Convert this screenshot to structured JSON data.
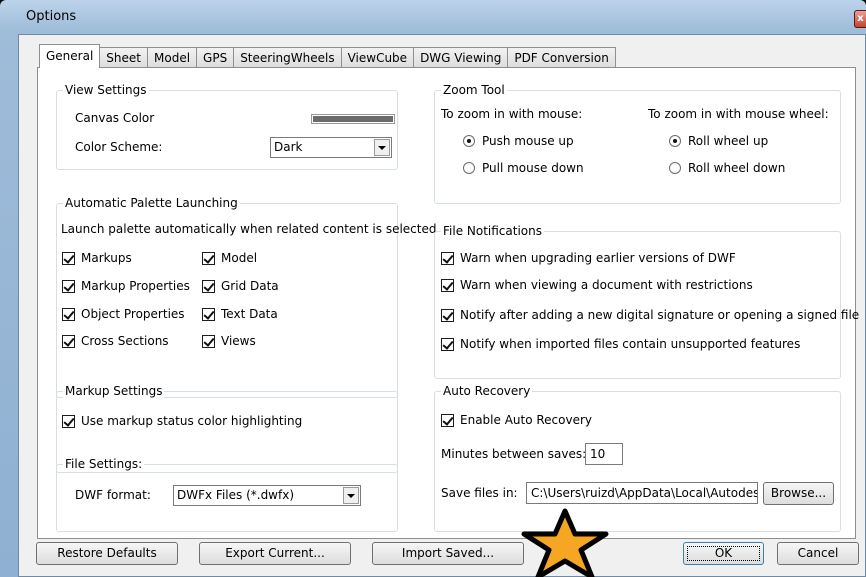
{
  "window": {
    "title": "Options",
    "close_glyph": "x"
  },
  "tabs": [
    "General",
    "Sheet",
    "Model",
    "GPS",
    "SteeringWheels",
    "ViewCube",
    "DWG Viewing",
    "PDF Conversion"
  ],
  "view_settings": {
    "legend": "View Settings",
    "canvas_color_label": "Canvas Color",
    "canvas_color_value": "#6b6b6b",
    "color_scheme_label": "Color Scheme:",
    "color_scheme_value": "Dark"
  },
  "palette": {
    "legend": "Automatic Palette Launching",
    "description": "Launch palette automatically when related content is selected",
    "items": [
      {
        "label": "Markups",
        "checked": true
      },
      {
        "label": "Model",
        "checked": true
      },
      {
        "label": "Markup Properties",
        "checked": true
      },
      {
        "label": "Grid Data",
        "checked": true
      },
      {
        "label": "Object Properties",
        "checked": true
      },
      {
        "label": "Text Data",
        "checked": true
      },
      {
        "label": "Cross Sections",
        "checked": true
      },
      {
        "label": "Views",
        "checked": true
      }
    ]
  },
  "markup_settings": {
    "legend": "Markup Settings",
    "highlight_label": "Use markup status color highlighting",
    "highlight_checked": true
  },
  "file_settings": {
    "legend": "File Settings:",
    "format_label": "DWF format:",
    "format_value": "DWFx Files (*.dwfx)"
  },
  "zoom_tool": {
    "legend": "Zoom Tool",
    "mouse_heading": "To zoom in with mouse:",
    "wheel_heading": "To zoom in with mouse wheel:",
    "mouse_options": [
      {
        "label": "Push mouse up",
        "selected": true
      },
      {
        "label": "Pull mouse down",
        "selected": false
      }
    ],
    "wheel_options": [
      {
        "label": "Roll wheel up",
        "selected": true
      },
      {
        "label": "Roll wheel down",
        "selected": false
      }
    ]
  },
  "file_notifications": {
    "legend": "File Notifications",
    "items": [
      {
        "label": "Warn when upgrading earlier versions of DWF",
        "checked": true
      },
      {
        "label": "Warn when viewing a document with restrictions",
        "checked": true
      },
      {
        "label": "Notify after adding a new digital signature or opening a signed file",
        "checked": true
      },
      {
        "label": "Notify when imported files contain unsupported features",
        "checked": true
      }
    ]
  },
  "auto_recovery": {
    "legend": "Auto Recovery",
    "enable_label": "Enable Auto Recovery",
    "enable_checked": true,
    "minutes_label": "Minutes between saves:",
    "minutes_value": "10",
    "save_in_label": "Save files in:",
    "save_path": "C:\\Users\\ruizd\\AppData\\Local\\Autodesk\\",
    "browse_label": "Browse..."
  },
  "buttons": {
    "restore": "Restore Defaults",
    "export": "Export Current...",
    "import": "Import Saved...",
    "ok": "OK",
    "cancel": "Cancel"
  },
  "colors": {
    "star_fill": "#f5a623",
    "star_outline": "#000000"
  }
}
